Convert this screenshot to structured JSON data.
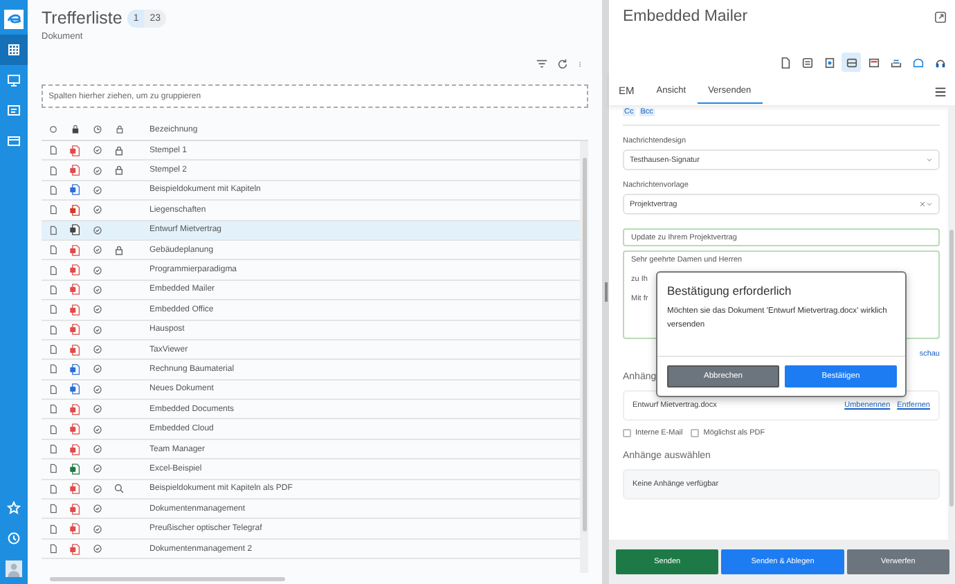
{
  "sidebar": {
    "items": [
      {
        "selected": true
      },
      {
        "selected": false
      },
      {
        "selected": false
      },
      {
        "selected": false
      }
    ]
  },
  "results": {
    "title": "Trefferliste",
    "badges": [
      {
        "text": "1",
        "selected": true
      },
      {
        "text": "23",
        "selected": false
      }
    ],
    "subtitle": "Dokument",
    "group_hint": "Spalten hierher ziehen, um zu gruppieren",
    "column_label": "Bezeichnung",
    "rows": [
      {
        "name": "Stempel 1",
        "kind": "pdf",
        "locked": true,
        "searchable": false,
        "selected": false
      },
      {
        "name": "Stempel 2",
        "kind": "pdf",
        "locked": true,
        "searchable": false,
        "selected": false
      },
      {
        "name": "Beispieldokument mit Kapiteln",
        "kind": "word",
        "locked": false,
        "searchable": false,
        "selected": false
      },
      {
        "name": "Liegenschaften",
        "kind": "ppt",
        "locked": false,
        "searchable": false,
        "selected": false
      },
      {
        "name": "Entwurf Mietvertrag",
        "kind": "mail",
        "locked": false,
        "searchable": false,
        "selected": true
      },
      {
        "name": "Gebäudeplanung",
        "kind": "pdf",
        "locked": true,
        "searchable": false,
        "selected": false
      },
      {
        "name": "Programmierparadigma",
        "kind": "pdf",
        "locked": false,
        "searchable": false,
        "selected": false
      },
      {
        "name": "Embedded Mailer",
        "kind": "pdf",
        "locked": false,
        "searchable": false,
        "selected": false
      },
      {
        "name": "Embedded Office",
        "kind": "pdf",
        "locked": false,
        "searchable": false,
        "selected": false
      },
      {
        "name": "Hauspost",
        "kind": "pdf",
        "locked": false,
        "searchable": false,
        "selected": false
      },
      {
        "name": "TaxViewer",
        "kind": "pdf",
        "locked": false,
        "searchable": false,
        "selected": false
      },
      {
        "name": "Rechnung Baumaterial",
        "kind": "word",
        "locked": false,
        "searchable": false,
        "selected": false
      },
      {
        "name": "Neues Dokument",
        "kind": "word",
        "locked": false,
        "searchable": false,
        "selected": false
      },
      {
        "name": "Embedded Documents",
        "kind": "pdf",
        "locked": false,
        "searchable": false,
        "selected": false
      },
      {
        "name": "Embedded Cloud",
        "kind": "pdf",
        "locked": false,
        "searchable": false,
        "selected": false
      },
      {
        "name": "Team Manager",
        "kind": "pdf",
        "locked": false,
        "searchable": false,
        "selected": false
      },
      {
        "name": "Excel-Beispiel",
        "kind": "excel",
        "locked": false,
        "searchable": false,
        "selected": false
      },
      {
        "name": "Beispieldokument mit Kapiteln als PDF",
        "kind": "pdf",
        "locked": false,
        "searchable": true,
        "selected": false
      },
      {
        "name": "Dokumentenmanagement",
        "kind": "pdf",
        "locked": false,
        "searchable": false,
        "selected": false
      },
      {
        "name": "Preußischer optischer Telegraf",
        "kind": "pdf",
        "locked": false,
        "searchable": false,
        "selected": false
      },
      {
        "name": "Dokumentenmanagement 2",
        "kind": "pdf",
        "locked": false,
        "searchable": false,
        "selected": false
      }
    ]
  },
  "mailer": {
    "title": "Embedded Mailer",
    "tools": [
      {
        "selected": false
      },
      {
        "selected": false
      },
      {
        "selected": false
      },
      {
        "selected": true
      },
      {
        "selected": false
      },
      {
        "selected": false
      },
      {
        "selected": false
      },
      {
        "selected": false
      }
    ],
    "tabs": [
      {
        "label": "EM",
        "selected": false
      },
      {
        "label": "Ansicht",
        "selected": false
      },
      {
        "label": "Versenden",
        "selected": true
      }
    ],
    "cc_links": [
      "Cc",
      "Bcc"
    ],
    "design_label": "Nachrichtendesign",
    "design_value": "Testhausen-Signatur",
    "template_label": "Nachrichtenvorlage",
    "template_value": "Projektvertrag",
    "subject": "Update zu Ihrem Projektvertrag",
    "body_lines": [
      "Sehr geehrte Damen und Herren",
      "zu Ih",
      "Mit fr"
    ],
    "preview_link": "schau",
    "attachments_heading": "Anhäng",
    "attachment": {
      "name": "Entwurf Mietvertrag.docx",
      "actions": [
        "Umbenennen",
        "Entfernen"
      ]
    },
    "options": [
      {
        "label": "Interne E-Mail",
        "checked": false
      },
      {
        "label": "Möglichst als PDF",
        "checked": false
      }
    ],
    "select_heading": "Anhänge auswählen",
    "empty_text": "Keine Anhänge verfügbar",
    "footer_buttons": [
      {
        "label": "Senden",
        "kind": "success"
      },
      {
        "label": "Senden & Ablegen",
        "kind": "primary"
      },
      {
        "label": "Verwerfen",
        "kind": "secondary"
      }
    ]
  },
  "dialog": {
    "title": "Bestätigung erforderlich",
    "message": "Möchten sie das Dokument 'Entwurf Mietvertrag.docx' wirklich versenden",
    "buttons": [
      {
        "label": "Abbrechen",
        "kind": "secondary"
      },
      {
        "label": "Bestätigen",
        "kind": "primary"
      }
    ]
  }
}
